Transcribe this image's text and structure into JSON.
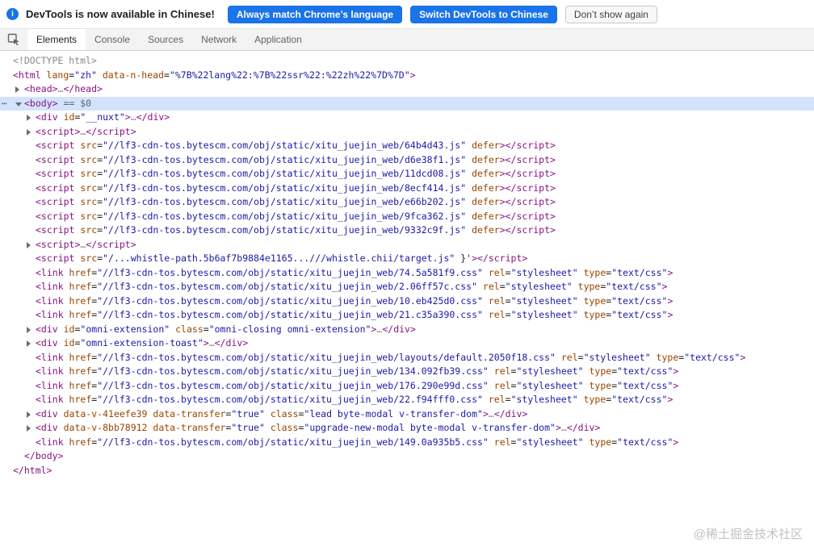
{
  "colors": {
    "accent": "#1a73e8",
    "tag": "#881280",
    "attr": "#994500",
    "value": "#1a1aa6",
    "comment": "#888888",
    "selection": "#d2e3fc",
    "tab-text": "#5f6368",
    "tab-active-text": "#202124"
  },
  "infobar": {
    "icon": "i",
    "message": "DevTools is now available in Chinese!",
    "buttons": [
      {
        "label": "Always match Chrome’s language",
        "style": "primary"
      },
      {
        "label": "Switch DevTools to Chinese",
        "style": "primary"
      },
      {
        "label": "Don’t show again",
        "style": "secondary"
      }
    ]
  },
  "tabs": [
    {
      "label": "Elements",
      "active": true
    },
    {
      "label": "Console",
      "active": false
    },
    {
      "label": "Sources",
      "active": false
    },
    {
      "label": "Network",
      "active": false
    },
    {
      "label": "Application",
      "active": false
    }
  ],
  "dom_tree": {
    "more_actions_icon": "⋯",
    "lines": [
      {
        "i": 0,
        "tok": [
          [
            "g",
            "<!DOCTYPE html>"
          ]
        ]
      },
      {
        "i": 0,
        "tok": [
          [
            "t",
            "<html"
          ],
          [
            "a",
            " lang"
          ],
          [
            "p",
            "="
          ],
          [
            "v",
            "\"zh\""
          ],
          [
            "a",
            " data-n-head"
          ],
          [
            "p",
            "="
          ],
          [
            "v",
            "\"%7B%22lang%22:%7B%22ssr%22:%22zh%22%7D%7D\""
          ],
          [
            "t",
            ">"
          ]
        ]
      },
      {
        "i": 1,
        "a": "r",
        "tok": [
          [
            "t",
            "<head>"
          ],
          [
            "g",
            "…"
          ],
          [
            "t",
            "</head>"
          ]
        ]
      },
      {
        "i": 1,
        "a": "d",
        "sel": true,
        "dots": true,
        "tok": [
          [
            "t",
            "<body>"
          ],
          [
            "m",
            " == $0"
          ]
        ]
      },
      {
        "i": 2,
        "a": "r",
        "tok": [
          [
            "t",
            "<div"
          ],
          [
            "a",
            " id"
          ],
          [
            "p",
            "="
          ],
          [
            "v",
            "\"__nuxt\""
          ],
          [
            "t",
            ">"
          ],
          [
            "g",
            "…"
          ],
          [
            "t",
            "</div>"
          ]
        ]
      },
      {
        "i": 2,
        "a": "r",
        "tok": [
          [
            "t",
            "<script>"
          ],
          [
            "g",
            "…"
          ],
          [
            "t",
            "</script>"
          ]
        ]
      },
      {
        "i": 2,
        "tok": [
          [
            "t",
            "<script"
          ],
          [
            "a",
            " src"
          ],
          [
            "p",
            "="
          ],
          [
            "v",
            "\"//lf3-cdn-tos.bytescm.com/obj/static/xitu_juejin_web/64b4d43.js\""
          ],
          [
            "a",
            " defer"
          ],
          [
            "t",
            "></script>"
          ]
        ]
      },
      {
        "i": 2,
        "tok": [
          [
            "t",
            "<script"
          ],
          [
            "a",
            " src"
          ],
          [
            "p",
            "="
          ],
          [
            "v",
            "\"//lf3-cdn-tos.bytescm.com/obj/static/xitu_juejin_web/d6e38f1.js\""
          ],
          [
            "a",
            " defer"
          ],
          [
            "t",
            "></script>"
          ]
        ]
      },
      {
        "i": 2,
        "tok": [
          [
            "t",
            "<script"
          ],
          [
            "a",
            " src"
          ],
          [
            "p",
            "="
          ],
          [
            "v",
            "\"//lf3-cdn-tos.bytescm.com/obj/static/xitu_juejin_web/11dcd08.js\""
          ],
          [
            "a",
            " defer"
          ],
          [
            "t",
            "></script>"
          ]
        ]
      },
      {
        "i": 2,
        "tok": [
          [
            "t",
            "<script"
          ],
          [
            "a",
            " src"
          ],
          [
            "p",
            "="
          ],
          [
            "v",
            "\"//lf3-cdn-tos.bytescm.com/obj/static/xitu_juejin_web/8ecf414.js\""
          ],
          [
            "a",
            " defer"
          ],
          [
            "t",
            "></script>"
          ]
        ]
      },
      {
        "i": 2,
        "tok": [
          [
            "t",
            "<script"
          ],
          [
            "a",
            " src"
          ],
          [
            "p",
            "="
          ],
          [
            "v",
            "\"//lf3-cdn-tos.bytescm.com/obj/static/xitu_juejin_web/e66b202.js\""
          ],
          [
            "a",
            " defer"
          ],
          [
            "t",
            "></script>"
          ]
        ]
      },
      {
        "i": 2,
        "tok": [
          [
            "t",
            "<script"
          ],
          [
            "a",
            " src"
          ],
          [
            "p",
            "="
          ],
          [
            "v",
            "\"//lf3-cdn-tos.bytescm.com/obj/static/xitu_juejin_web/9fca362.js\""
          ],
          [
            "a",
            " defer"
          ],
          [
            "t",
            "></script>"
          ]
        ]
      },
      {
        "i": 2,
        "tok": [
          [
            "t",
            "<script"
          ],
          [
            "a",
            " src"
          ],
          [
            "p",
            "="
          ],
          [
            "v",
            "\"//lf3-cdn-tos.bytescm.com/obj/static/xitu_juejin_web/9332c9f.js\""
          ],
          [
            "a",
            " defer"
          ],
          [
            "t",
            "></script>"
          ]
        ]
      },
      {
        "i": 2,
        "a": "r",
        "tok": [
          [
            "t",
            "<script>"
          ],
          [
            "g",
            "…"
          ],
          [
            "t",
            "</script>"
          ]
        ]
      },
      {
        "i": 2,
        "tok": [
          [
            "t",
            "<script"
          ],
          [
            "a",
            " src"
          ],
          [
            "p",
            "="
          ],
          [
            "v",
            "\"/...whistle-path.5b6af7b9884e1165...///whistle.chii/target.js\""
          ],
          [
            "p",
            " }'"
          ],
          [
            "t",
            "></script>"
          ]
        ]
      },
      {
        "i": 2,
        "tok": [
          [
            "t",
            "<link"
          ],
          [
            "a",
            " href"
          ],
          [
            "p",
            "="
          ],
          [
            "v",
            "\"//lf3-cdn-tos.bytescm.com/obj/static/xitu_juejin_web/74.5a581f9.css\""
          ],
          [
            "a",
            " rel"
          ],
          [
            "p",
            "="
          ],
          [
            "v",
            "\"stylesheet\""
          ],
          [
            "a",
            " type"
          ],
          [
            "p",
            "="
          ],
          [
            "v",
            "\"text/css\""
          ],
          [
            "t",
            ">"
          ]
        ]
      },
      {
        "i": 2,
        "tok": [
          [
            "t",
            "<link"
          ],
          [
            "a",
            " href"
          ],
          [
            "p",
            "="
          ],
          [
            "v",
            "\"//lf3-cdn-tos.bytescm.com/obj/static/xitu_juejin_web/2.06ff57c.css\""
          ],
          [
            "a",
            " rel"
          ],
          [
            "p",
            "="
          ],
          [
            "v",
            "\"stylesheet\""
          ],
          [
            "a",
            " type"
          ],
          [
            "p",
            "="
          ],
          [
            "v",
            "\"text/css\""
          ],
          [
            "t",
            ">"
          ]
        ]
      },
      {
        "i": 2,
        "tok": [
          [
            "t",
            "<link"
          ],
          [
            "a",
            " href"
          ],
          [
            "p",
            "="
          ],
          [
            "v",
            "\"//lf3-cdn-tos.bytescm.com/obj/static/xitu_juejin_web/10.eb425d0.css\""
          ],
          [
            "a",
            " rel"
          ],
          [
            "p",
            "="
          ],
          [
            "v",
            "\"stylesheet\""
          ],
          [
            "a",
            " type"
          ],
          [
            "p",
            "="
          ],
          [
            "v",
            "\"text/css\""
          ],
          [
            "t",
            ">"
          ]
        ]
      },
      {
        "i": 2,
        "tok": [
          [
            "t",
            "<link"
          ],
          [
            "a",
            " href"
          ],
          [
            "p",
            "="
          ],
          [
            "v",
            "\"//lf3-cdn-tos.bytescm.com/obj/static/xitu_juejin_web/21.c35a390.css\""
          ],
          [
            "a",
            " rel"
          ],
          [
            "p",
            "="
          ],
          [
            "v",
            "\"stylesheet\""
          ],
          [
            "a",
            " type"
          ],
          [
            "p",
            "="
          ],
          [
            "v",
            "\"text/css\""
          ],
          [
            "t",
            ">"
          ]
        ]
      },
      {
        "i": 2,
        "a": "r",
        "tok": [
          [
            "t",
            "<div"
          ],
          [
            "a",
            " id"
          ],
          [
            "p",
            "="
          ],
          [
            "v",
            "\"omni-extension\""
          ],
          [
            "a",
            " class"
          ],
          [
            "p",
            "="
          ],
          [
            "v",
            "\"omni-closing omni-extension\""
          ],
          [
            "t",
            ">"
          ],
          [
            "g",
            "…"
          ],
          [
            "t",
            "</div>"
          ]
        ]
      },
      {
        "i": 2,
        "a": "r",
        "tok": [
          [
            "t",
            "<div"
          ],
          [
            "a",
            " id"
          ],
          [
            "p",
            "="
          ],
          [
            "v",
            "\"omni-extension-toast\""
          ],
          [
            "t",
            ">"
          ],
          [
            "g",
            "…"
          ],
          [
            "t",
            "</div>"
          ]
        ]
      },
      {
        "i": 2,
        "tok": [
          [
            "t",
            "<link"
          ],
          [
            "a",
            " href"
          ],
          [
            "p",
            "="
          ],
          [
            "v",
            "\"//lf3-cdn-tos.bytescm.com/obj/static/xitu_juejin_web/layouts/default.2050f18.css\""
          ],
          [
            "a",
            " rel"
          ],
          [
            "p",
            "="
          ],
          [
            "v",
            "\"stylesheet\""
          ],
          [
            "a",
            " type"
          ],
          [
            "p",
            "="
          ],
          [
            "v",
            "\"text/css\""
          ],
          [
            "t",
            ">"
          ]
        ]
      },
      {
        "i": 2,
        "tok": [
          [
            "t",
            "<link"
          ],
          [
            "a",
            " href"
          ],
          [
            "p",
            "="
          ],
          [
            "v",
            "\"//lf3-cdn-tos.bytescm.com/obj/static/xitu_juejin_web/134.092fb39.css\""
          ],
          [
            "a",
            " rel"
          ],
          [
            "p",
            "="
          ],
          [
            "v",
            "\"stylesheet\""
          ],
          [
            "a",
            " type"
          ],
          [
            "p",
            "="
          ],
          [
            "v",
            "\"text/css\""
          ],
          [
            "t",
            ">"
          ]
        ]
      },
      {
        "i": 2,
        "tok": [
          [
            "t",
            "<link"
          ],
          [
            "a",
            " href"
          ],
          [
            "p",
            "="
          ],
          [
            "v",
            "\"//lf3-cdn-tos.bytescm.com/obj/static/xitu_juejin_web/176.290e99d.css\""
          ],
          [
            "a",
            " rel"
          ],
          [
            "p",
            "="
          ],
          [
            "v",
            "\"stylesheet\""
          ],
          [
            "a",
            " type"
          ],
          [
            "p",
            "="
          ],
          [
            "v",
            "\"text/css\""
          ],
          [
            "t",
            ">"
          ]
        ]
      },
      {
        "i": 2,
        "tok": [
          [
            "t",
            "<link"
          ],
          [
            "a",
            " href"
          ],
          [
            "p",
            "="
          ],
          [
            "v",
            "\"//lf3-cdn-tos.bytescm.com/obj/static/xitu_juejin_web/22.f94fff0.css\""
          ],
          [
            "a",
            " rel"
          ],
          [
            "p",
            "="
          ],
          [
            "v",
            "\"stylesheet\""
          ],
          [
            "a",
            " type"
          ],
          [
            "p",
            "="
          ],
          [
            "v",
            "\"text/css\""
          ],
          [
            "t",
            ">"
          ]
        ]
      },
      {
        "i": 2,
        "a": "r",
        "tok": [
          [
            "t",
            "<div"
          ],
          [
            "a",
            " data-v-41eefe39"
          ],
          [
            "a",
            " data-transfer"
          ],
          [
            "p",
            "="
          ],
          [
            "v",
            "\"true\""
          ],
          [
            "a",
            " class"
          ],
          [
            "p",
            "="
          ],
          [
            "v",
            "\"lead byte-modal v-transfer-dom\""
          ],
          [
            "t",
            ">"
          ],
          [
            "g",
            "…"
          ],
          [
            "t",
            "</div>"
          ]
        ]
      },
      {
        "i": 2,
        "a": "r",
        "tok": [
          [
            "t",
            "<div"
          ],
          [
            "a",
            " data-v-8bb78912"
          ],
          [
            "a",
            " data-transfer"
          ],
          [
            "p",
            "="
          ],
          [
            "v",
            "\"true\""
          ],
          [
            "a",
            " class"
          ],
          [
            "p",
            "="
          ],
          [
            "v",
            "\"upgrade-new-modal byte-modal v-transfer-dom\""
          ],
          [
            "t",
            ">"
          ],
          [
            "g",
            "…"
          ],
          [
            "t",
            "</div>"
          ]
        ]
      },
      {
        "i": 2,
        "tok": [
          [
            "t",
            "<link"
          ],
          [
            "a",
            " href"
          ],
          [
            "p",
            "="
          ],
          [
            "v",
            "\"//lf3-cdn-tos.bytescm.com/obj/static/xitu_juejin_web/149.0a935b5.css\""
          ],
          [
            "a",
            " rel"
          ],
          [
            "p",
            "="
          ],
          [
            "v",
            "\"stylesheet\""
          ],
          [
            "a",
            " type"
          ],
          [
            "p",
            "="
          ],
          [
            "v",
            "\"text/css\""
          ],
          [
            "t",
            ">"
          ]
        ]
      },
      {
        "i": 1,
        "tok": [
          [
            "t",
            "</body>"
          ]
        ]
      },
      {
        "i": 0,
        "tok": [
          [
            "t",
            "</html>"
          ]
        ]
      }
    ]
  },
  "watermark": "@稀土掘金技术社区"
}
